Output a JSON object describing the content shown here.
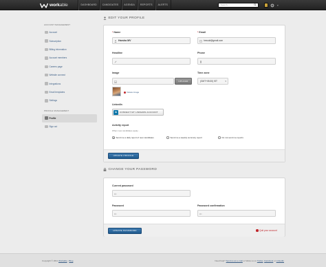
{
  "brand": {
    "name_bold": "work",
    "name_rest": "able"
  },
  "nav": [
    "DASHBOARD",
    "CANDIDATES",
    "AGENDA",
    "REPORTS",
    "ALERTS"
  ],
  "search": {
    "placeholder": "Search..."
  },
  "sidebar": {
    "account_title": "ACCOUNT MANAGEMENT",
    "account_items": [
      {
        "label": "Account",
        "icon": "account-icon"
      },
      {
        "label": "Subscription",
        "icon": "subscription-icon"
      },
      {
        "label": "Billing information",
        "icon": "billing-icon"
      },
      {
        "label": "Account members",
        "icon": "members-icon"
      },
      {
        "label": "Careers page",
        "icon": "careers-icon"
      },
      {
        "label": "Website connect",
        "icon": "website-icon"
      },
      {
        "label": "Integrations",
        "icon": "integrations-icon"
      },
      {
        "label": "Email templates",
        "icon": "email-icon"
      },
      {
        "label": "Settings",
        "icon": "gear-icon"
      }
    ],
    "profile_title": "PROFILE MANAGEMENT",
    "profile_items": [
      {
        "label": "Profile",
        "icon": "profile-icon"
      },
      {
        "label": "Sign out",
        "icon": "signout-icon"
      }
    ]
  },
  "profile": {
    "heading": "EDIT YOUR PROFILE",
    "name_label": "Name",
    "name_value": "Harsha MV",
    "email_label": "Email",
    "email_value": "hmvuid@gmail.com",
    "headline_label": "Headline",
    "phone_label": "Phone",
    "image_label": "Image",
    "upload_label": "UPLOAD",
    "remove_image": "Delete image",
    "timezone_label": "Time zone",
    "timezone_value": "(GMT+05:30) IST",
    "linkedin_label": "LinkedIn",
    "linkedin_button": "CONNECT MY LINKEDIN ACCOUNT",
    "activity_label": "Activity report",
    "activity_hint": "When new candidates apply...",
    "activity_options": [
      {
        "label": "Send me a daily report of new candidates",
        "checked": true
      },
      {
        "label": "Send me a weekly summary report",
        "checked": false
      },
      {
        "label": "Do not send me reports",
        "checked": false
      }
    ],
    "submit": "UPDATE PROFILE"
  },
  "password": {
    "heading": "CHANGE YOUR PASSWORD",
    "current_label": "Current password",
    "new_label": "Password",
    "confirm_label": "Password confirmation",
    "submit": "UPDATE PASSWORD",
    "quit": "Quit your account"
  },
  "footer": {
    "copyright": "Copyright © 2011",
    "workable": "Workable",
    "blog": "Blog",
    "need_help": "Need help?",
    "send_email": "Send us an e-mail",
    "follow": "or follow us on",
    "twitter": "Twitter",
    "facebook": "Facebook",
    "linkedin": "LinkedIn"
  },
  "colors": {
    "accent": "#205a8e",
    "danger": "#c0282d",
    "topbar": "#2b2b2b"
  }
}
